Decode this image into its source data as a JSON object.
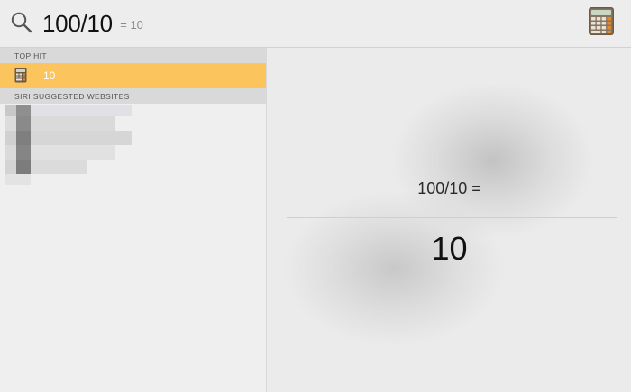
{
  "search": {
    "query": "100/10",
    "inline_result": "= 10"
  },
  "icons": {
    "search": "search-icon",
    "calculator": "calculator-icon"
  },
  "results": {
    "top_hit_header": "TOP HIT",
    "top_hit_label": "10",
    "websites_header": "SIRI SUGGESTED WEBSITES"
  },
  "preview": {
    "expression": "100/10 =",
    "answer": "10"
  },
  "colors": {
    "selection": "#fcc45c",
    "section_header_bg": "#d9d9d9"
  }
}
